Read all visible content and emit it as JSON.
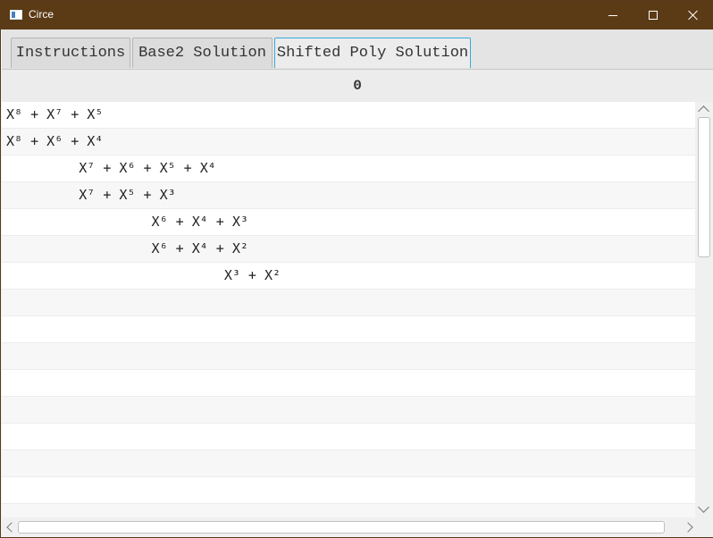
{
  "window": {
    "title": "Circe",
    "icon": "app-window-icon",
    "controls": [
      "minimize-icon",
      "maximize-icon",
      "close-icon"
    ]
  },
  "tabs": [
    {
      "label": "Instructions",
      "active": false
    },
    {
      "label": "Base2 Solution",
      "active": false
    },
    {
      "label": "Shifted Poly Solution",
      "active": true
    }
  ],
  "header": {
    "value": "0"
  },
  "rows": [
    "X⁸ + X⁷ + X⁵",
    "X⁸ + X⁶ + X⁴",
    "         X⁷ + X⁶ + X⁵ + X⁴",
    "         X⁷ + X⁵ + X³",
    "                  X⁶ + X⁴ + X³",
    "                  X⁶ + X⁴ + X²",
    "                           X³ + X²",
    "",
    "",
    "",
    "",
    "",
    "",
    "",
    "",
    ""
  ],
  "colors": {
    "titlebar": "#5b3a16",
    "active_tab_border": "#38a9d9"
  }
}
